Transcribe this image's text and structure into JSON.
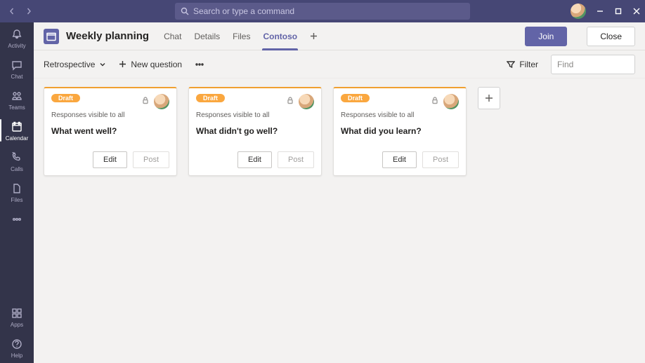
{
  "titlebar": {
    "search_placeholder": "Search or type a command"
  },
  "rail": {
    "items": [
      {
        "id": "activity",
        "label": "Activity"
      },
      {
        "id": "chat",
        "label": "Chat"
      },
      {
        "id": "teams",
        "label": "Teams"
      },
      {
        "id": "calendar",
        "label": "Calendar"
      },
      {
        "id": "calls",
        "label": "Calls"
      },
      {
        "id": "files",
        "label": "Files"
      }
    ],
    "bottom": [
      {
        "id": "apps",
        "label": "Apps"
      },
      {
        "id": "help",
        "label": "Help"
      }
    ]
  },
  "header": {
    "title": "Weekly planning",
    "tabs": [
      {
        "id": "chat",
        "label": "Chat"
      },
      {
        "id": "details",
        "label": "Details"
      },
      {
        "id": "files",
        "label": "Files"
      },
      {
        "id": "contoso",
        "label": "Contoso"
      }
    ],
    "join": "Join",
    "close": "Close"
  },
  "toolbar": {
    "dropdown": "Retrospective",
    "new_question": "New question",
    "filter": "Filter",
    "find_placeholder": "Find"
  },
  "cards": [
    {
      "badge": "Draft",
      "note": "Responses visible to all",
      "question": "What went well?",
      "edit": "Edit",
      "post": "Post"
    },
    {
      "badge": "Draft",
      "note": "Responses visible to all",
      "question": "What didn't go well?",
      "edit": "Edit",
      "post": "Post"
    },
    {
      "badge": "Draft",
      "note": "Responses visible to all",
      "question": "What did you learn?",
      "edit": "Edit",
      "post": "Post"
    }
  ]
}
